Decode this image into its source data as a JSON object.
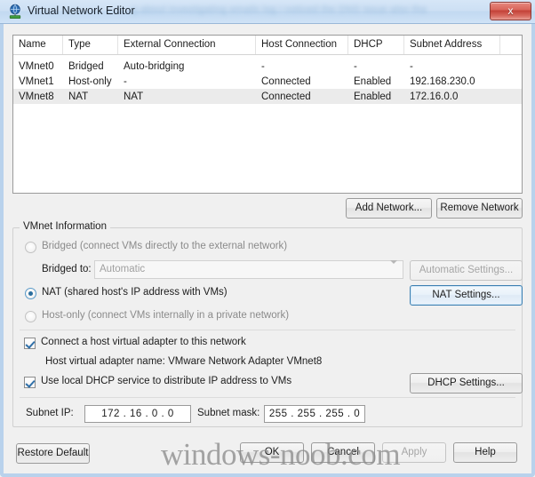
{
  "window": {
    "title": "Virtual Network Editor",
    "icon": "network-monitor-icon",
    "close_label": "x",
    "blurred_background_text": "g about investigating emails log i noticed the DNS issue also tha",
    "frame_color": "#b9d2ec",
    "titlebar_color": "#cde0f4",
    "body_color": "#f0f0f0"
  },
  "table": {
    "columns": [
      "Name",
      "Type",
      "External Connection",
      "Host Connection",
      "DHCP",
      "Subnet Address",
      ""
    ],
    "rows": [
      {
        "name": "VMnet0",
        "type": "Bridged",
        "external_connection": "Auto-bridging",
        "host_connection": "-",
        "dhcp": "-",
        "subnet_address": "-",
        "selected": false
      },
      {
        "name": "VMnet1",
        "type": "Host-only",
        "external_connection": "-",
        "host_connection": "Connected",
        "dhcp": "Enabled",
        "subnet_address": "192.168.230.0",
        "selected": false
      },
      {
        "name": "VMnet8",
        "type": "NAT",
        "external_connection": "NAT",
        "host_connection": "Connected",
        "dhcp": "Enabled",
        "subnet_address": "172.16.0.0",
        "selected": true
      }
    ],
    "selected_row_color": "#ebebeb"
  },
  "table_actions": {
    "add_network": "Add Network...",
    "remove_network": "Remove Network"
  },
  "vmnet_information": {
    "group_label": "VMnet Information",
    "bridged": {
      "label": "Bridged (connect VMs directly to the external network)",
      "selected": false,
      "enabled": false
    },
    "bridged_to": {
      "label": "Bridged to:",
      "value": "Automatic",
      "enabled": false,
      "settings_button": "Automatic Settings..."
    },
    "nat": {
      "label": "NAT (shared host's IP address with VMs)",
      "selected": true,
      "enabled": true,
      "settings_button": "NAT Settings...",
      "settings_focused": true
    },
    "host_only": {
      "label": "Host-only (connect VMs internally in a private network)",
      "selected": false,
      "enabled": false
    },
    "connect_host_adapter": {
      "label": "Connect a host virtual adapter to this network",
      "checked": true
    },
    "host_adapter_name": "Host virtual adapter name: VMware Network Adapter VMnet8",
    "local_dhcp": {
      "label": "Use local DHCP service to distribute IP address to VMs",
      "checked": true,
      "settings_button": "DHCP Settings..."
    },
    "subnet_ip": {
      "label": "Subnet IP:",
      "value": "172 . 16 .  0  .  0"
    },
    "subnet_mask": {
      "label": "Subnet mask:",
      "value": "255 . 255 . 255 . 0"
    }
  },
  "footer": {
    "restore_default": "Restore Default",
    "ok": "OK",
    "cancel": "Cancel",
    "apply": "Apply",
    "apply_enabled": false,
    "help": "Help"
  },
  "watermark": "windows-noob.com"
}
